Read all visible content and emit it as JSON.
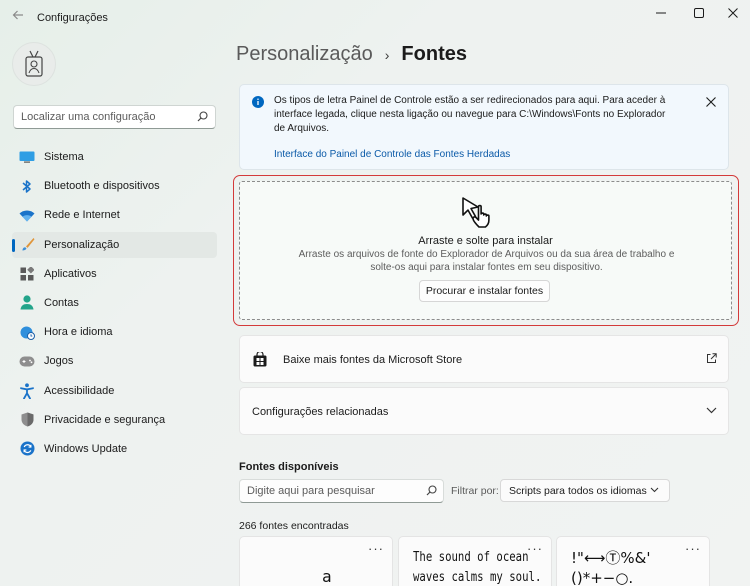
{
  "window": {
    "title": "Configurações"
  },
  "search": {
    "placeholder": "Localizar uma configuração"
  },
  "sidebar": {
    "items": [
      {
        "label": "Sistema",
        "icon": "monitor-icon"
      },
      {
        "label": "Bluetooth e dispositivos",
        "icon": "bluetooth-icon"
      },
      {
        "label": "Rede e Internet",
        "icon": "wifi-icon"
      },
      {
        "label": "Personalização",
        "icon": "brush-icon",
        "selected": true
      },
      {
        "label": "Aplicativos",
        "icon": "apps-icon"
      },
      {
        "label": "Contas",
        "icon": "person-icon"
      },
      {
        "label": "Hora e idioma",
        "icon": "globe-clock-icon"
      },
      {
        "label": "Jogos",
        "icon": "gamepad-icon"
      },
      {
        "label": "Acessibilidade",
        "icon": "accessibility-icon"
      },
      {
        "label": "Privacidade e segurança",
        "icon": "shield-icon"
      },
      {
        "label": "Windows Update",
        "icon": "update-icon"
      }
    ]
  },
  "breadcrumb": {
    "parent": "Personalização",
    "separator": "›",
    "current": "Fontes"
  },
  "infobar": {
    "text": "Os tipos de letra Painel de Controle estão a ser redirecionados para aqui. Para aceder à interface legada, clique nesta ligação ou navegue para C:\\Windows\\Fonts no Explorador de Arquivos.",
    "link": "Interface do Painel de Controle das Fontes Herdadas"
  },
  "dropzone": {
    "title": "Arraste e solte para instalar",
    "description": "Arraste os arquivos de fonte do Explorador de Arquivos ou da sua área de trabalho e solte-os aqui para instalar fontes em seu dispositivo.",
    "button": "Procurar e instalar fontes"
  },
  "store_card": {
    "label": "Baixe mais fontes da Microsoft Store"
  },
  "related_card": {
    "label": "Configurações relacionadas"
  },
  "fonts": {
    "section_title": "Fontes disponíveis",
    "search_placeholder": "Digite aqui para pesquisar",
    "filter_label": "Filtrar por:",
    "filter_value": "Scripts para todos os idiomas",
    "count": "266 fontes encontradas",
    "more_label": "···",
    "previews": [
      {
        "text": "a"
      },
      {
        "line1": "The sound of ocean",
        "line2": "waves calms my soul."
      },
      {
        "line1": "!\"⟷Ⓣ%&'",
        "line2": "()*+−○."
      }
    ]
  },
  "colors": {
    "accent": "#0067c0",
    "highlight_border": "#d33a3a",
    "link": "#0b5aa8"
  }
}
